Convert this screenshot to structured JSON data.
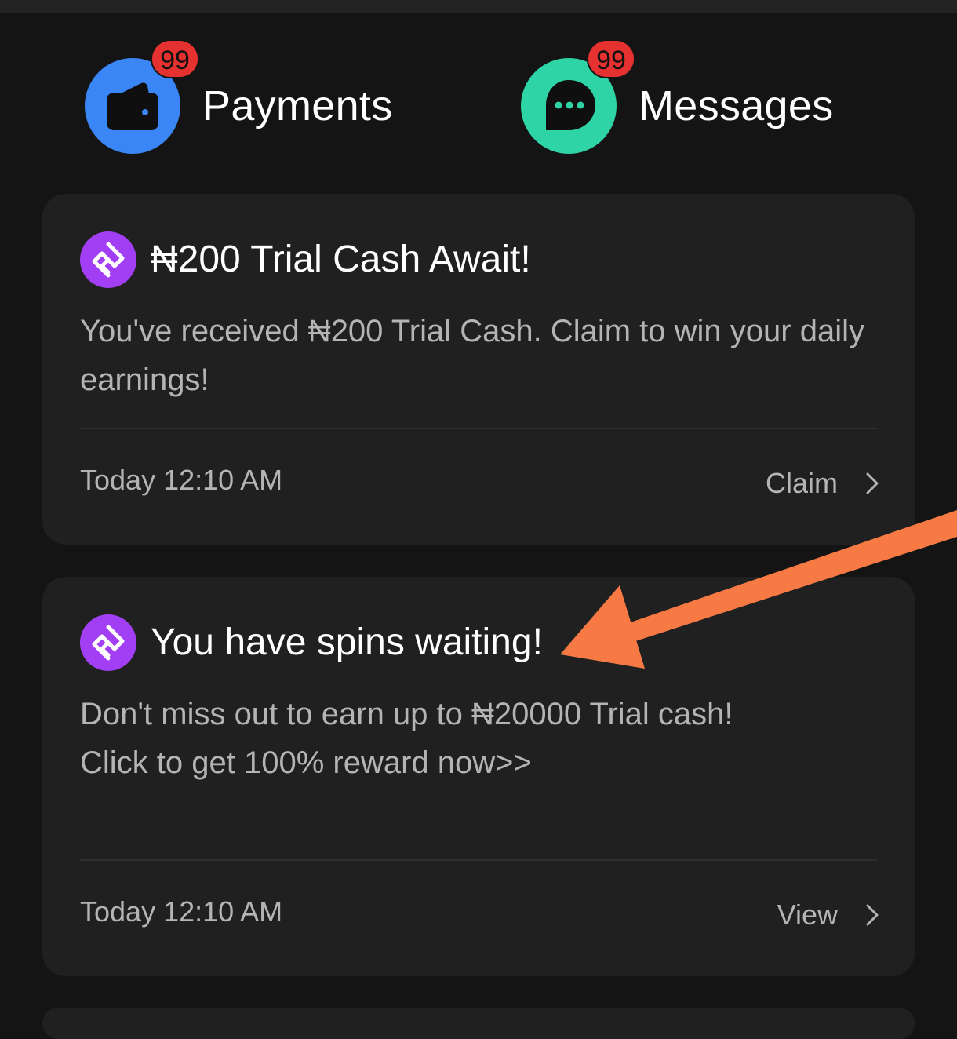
{
  "quick_actions": {
    "payments": {
      "label": "Payments",
      "badge": "99",
      "icon": "wallet-icon",
      "color": "#3b86f7"
    },
    "messages": {
      "label": "Messages",
      "badge": "99",
      "icon": "chat-bubble-icon",
      "color": "#2ed3a6"
    }
  },
  "notifications": [
    {
      "icon": "app-logo-icon",
      "title": "₦200 Trial Cash Await!",
      "body": "You've received ₦200 Trial Cash. Claim to win your daily earnings!",
      "time": "Today 12:10 AM",
      "action": "Claim"
    },
    {
      "icon": "app-logo-icon",
      "title": "You have spins waiting!",
      "body_line1": "Don't miss out to earn up to ₦20000 Trial cash!",
      "body_line2": "Click to get 100% reward now>>",
      "time": "Today 12:10 AM",
      "action": "View"
    }
  ],
  "colors": {
    "background": "#141414",
    "card": "#202020",
    "badge": "#e5312f",
    "logo": "#a23ff5",
    "annotation_arrow": "#f77a45"
  }
}
